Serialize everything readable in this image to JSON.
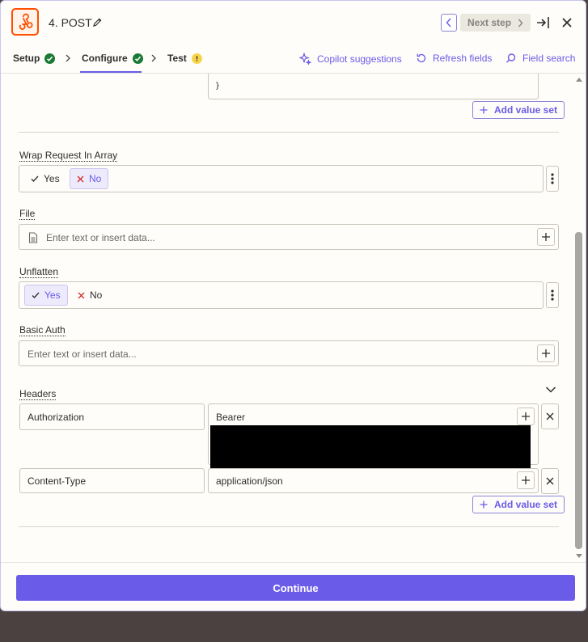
{
  "header": {
    "title": "4. POST",
    "next_step_label": "Next step"
  },
  "tabs": [
    {
      "label": "Setup",
      "status": "complete"
    },
    {
      "label": "Configure",
      "status": "complete"
    },
    {
      "label": "Test",
      "status": "warning"
    }
  ],
  "actions": {
    "copilot": "Copilot suggestions",
    "refresh": "Refresh fields",
    "search": "Field search"
  },
  "body": {
    "closing_brace": "}",
    "add_value_set": "Add value set",
    "wrap": {
      "label": "Wrap Request In Array",
      "yes": "Yes",
      "no": "No",
      "selected": "No"
    },
    "file": {
      "label": "File",
      "placeholder": "Enter text or insert data..."
    },
    "unflatten": {
      "label": "Unflatten",
      "yes": "Yes",
      "no": "No",
      "selected": "Yes"
    },
    "basic_auth": {
      "label": "Basic Auth",
      "placeholder": "Enter text or insert data..."
    },
    "headers": {
      "label": "Headers",
      "rows": [
        {
          "key": "Authorization",
          "value": "Bearer"
        },
        {
          "key": "Content-Type",
          "value": "application/json"
        }
      ]
    }
  },
  "footer": {
    "continue_label": "Continue"
  },
  "colors": {
    "accent": "#695be8",
    "brand": "#ff4f00",
    "success": "#1b7a35",
    "warning": "#f7d54a"
  }
}
